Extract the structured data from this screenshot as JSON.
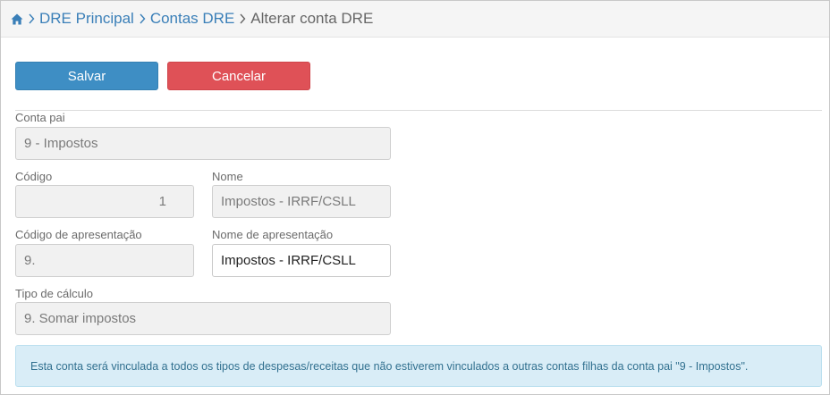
{
  "breadcrumb": {
    "home_icon": "home-icon",
    "items": [
      "DRE Principal",
      "Contas DRE"
    ],
    "current": "Alterar conta DRE"
  },
  "actions": {
    "save_label": "Salvar",
    "cancel_label": "Cancelar"
  },
  "form": {
    "conta_pai": {
      "label": "Conta pai",
      "value": "9 - Impostos"
    },
    "codigo": {
      "label": "Código",
      "value": "1"
    },
    "nome": {
      "label": "Nome",
      "value": "Impostos - IRRF/CSLL"
    },
    "codigo_apresentacao": {
      "label": "Código de apresentação",
      "value": "9."
    },
    "nome_apresentacao": {
      "label": "Nome de apresentação",
      "value": "Impostos - IRRF/CSLL"
    },
    "tipo_calculo": {
      "label": "Tipo de cálculo",
      "value": "9. Somar impostos"
    }
  },
  "info_message": "Esta conta será vinculada a todos os tipos de despesas/receitas que não estiverem vinculados a outras contas filhas da conta pai \"9 - Impostos\".",
  "colors": {
    "primary": "#3e8ec4",
    "danger": "#df5157",
    "info_bg": "#d9edf7",
    "link": "#3a7fb8"
  }
}
